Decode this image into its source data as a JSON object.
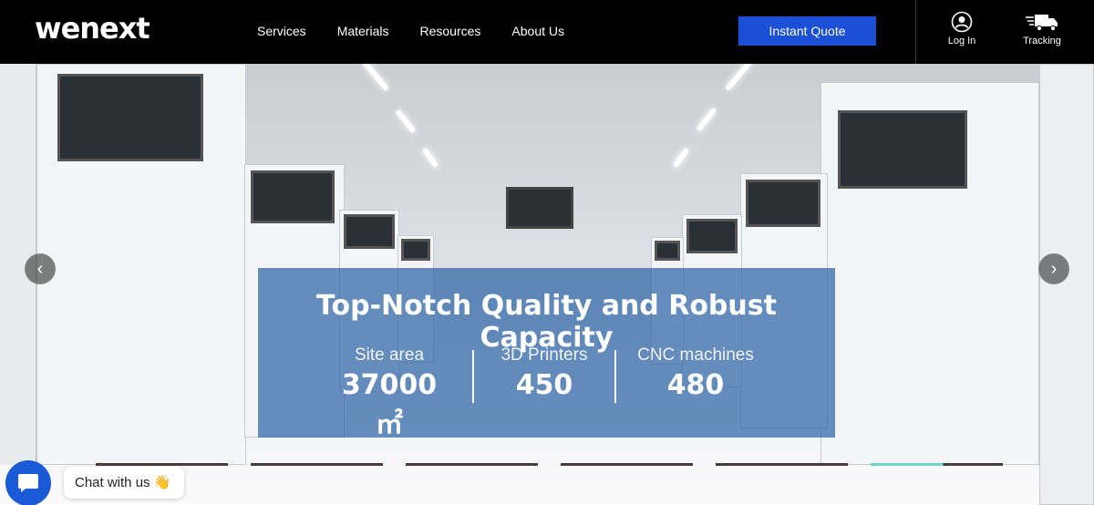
{
  "header": {
    "logo": "wenext",
    "nav": [
      "Services",
      "Materials",
      "Resources",
      "About Us"
    ],
    "cta_label": "Instant Quote",
    "login_label": "Log In",
    "tracking_label": "Tracking"
  },
  "hero": {
    "title": "Top-Notch Quality and Robust Capacity",
    "stats": [
      {
        "label": "Site area",
        "value": "37000㎡"
      },
      {
        "label": "3D Printers",
        "value": "450"
      },
      {
        "label": "CNC machines",
        "value": "480"
      }
    ],
    "slides_total": 6,
    "active_slide": 6
  },
  "chat": {
    "label": "Chat with us 👋"
  },
  "colors": {
    "accent": "#1a4fd6",
    "overlay": "#2d64a5",
    "chat": "#1a5ad6"
  },
  "icons": {
    "prev": "chevron-left-icon",
    "next": "chevron-right-icon",
    "login": "user-icon",
    "tracking": "truck-icon",
    "chat": "chat-icon"
  }
}
